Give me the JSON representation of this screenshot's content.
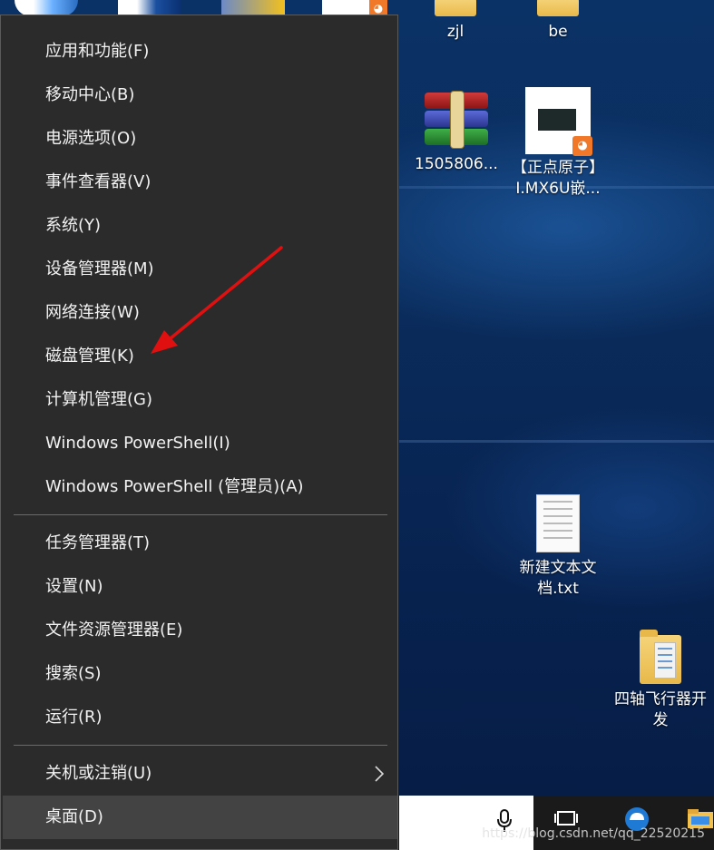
{
  "desktop": {
    "icons": [
      {
        "id": "zjl",
        "label": "zjl",
        "type": "folder"
      },
      {
        "id": "be",
        "label": "be",
        "type": "folder"
      },
      {
        "id": "rar",
        "label": "1505806...",
        "type": "winrar-archive"
      },
      {
        "id": "pdf",
        "label": "【正点原子】I.MX6U嵌...",
        "type": "pdf-document"
      },
      {
        "id": "txt",
        "label": "新建文本文档.txt",
        "type": "text-document"
      },
      {
        "id": "quad",
        "label": "四轴飞行器开发",
        "type": "folder"
      }
    ]
  },
  "menu": {
    "group1": [
      {
        "label": "应用和功能(F)"
      },
      {
        "label": "移动中心(B)"
      },
      {
        "label": "电源选项(O)"
      },
      {
        "label": "事件查看器(V)"
      },
      {
        "label": "系统(Y)"
      },
      {
        "label": "设备管理器(M)"
      },
      {
        "label": "网络连接(W)"
      },
      {
        "label": "磁盘管理(K)"
      },
      {
        "label": "计算机管理(G)"
      },
      {
        "label": "Windows PowerShell(I)"
      },
      {
        "label": "Windows PowerShell (管理员)(A)"
      }
    ],
    "group2": [
      {
        "label": "任务管理器(T)"
      },
      {
        "label": "设置(N)"
      },
      {
        "label": "文件资源管理器(E)"
      },
      {
        "label": "搜索(S)"
      },
      {
        "label": "运行(R)"
      }
    ],
    "group3": [
      {
        "label": "关机或注销(U)",
        "has_submenu": true
      },
      {
        "label": "桌面(D)",
        "highlighted": true
      }
    ]
  },
  "annotation": {
    "color": "#e01010",
    "target": "磁盘管理(K)"
  },
  "taskbar": {
    "icons": [
      "microphone-icon",
      "task-view-icon",
      "edge-icon",
      "file-explorer-icon"
    ]
  },
  "watermark": "https://blog.csdn.net/qq_22520215"
}
